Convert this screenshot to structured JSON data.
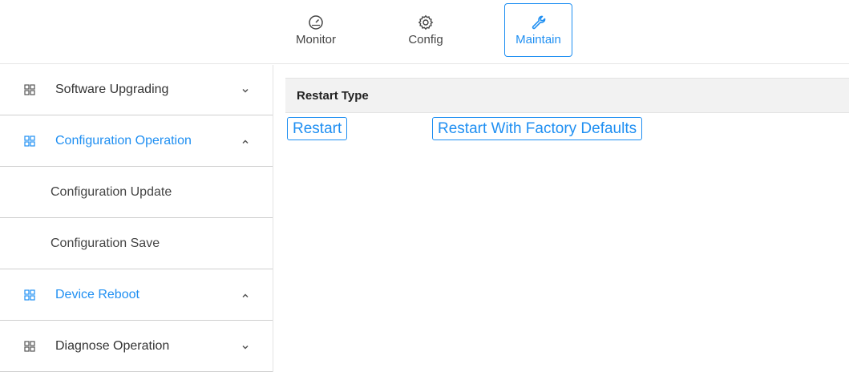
{
  "topnav": {
    "items": [
      {
        "label": "Monitor",
        "icon": "gauge-icon"
      },
      {
        "label": "Config",
        "icon": "gear-icon"
      },
      {
        "label": "Maintain",
        "icon": "wrench-icon",
        "active": true
      }
    ]
  },
  "sidebar": {
    "items": [
      {
        "label": "Software Upgrading",
        "expanded": false
      },
      {
        "label": "Configuration Operation",
        "expanded": true,
        "active": true
      },
      {
        "label": "Configuration Update",
        "sub": true
      },
      {
        "label": "Configuration Save",
        "sub": true
      },
      {
        "label": "Device Reboot",
        "expanded": true,
        "active": true
      },
      {
        "label": "Diagnose Operation",
        "expanded": false
      }
    ]
  },
  "main": {
    "section_title": "Restart Type",
    "buttons": {
      "restart": "Restart",
      "factory": "Restart With Factory Defaults"
    }
  },
  "colors": {
    "accent": "#1f8ff2",
    "text": "#333333",
    "header_bg": "#f2f2f2",
    "divider": "#cfcfcf"
  }
}
